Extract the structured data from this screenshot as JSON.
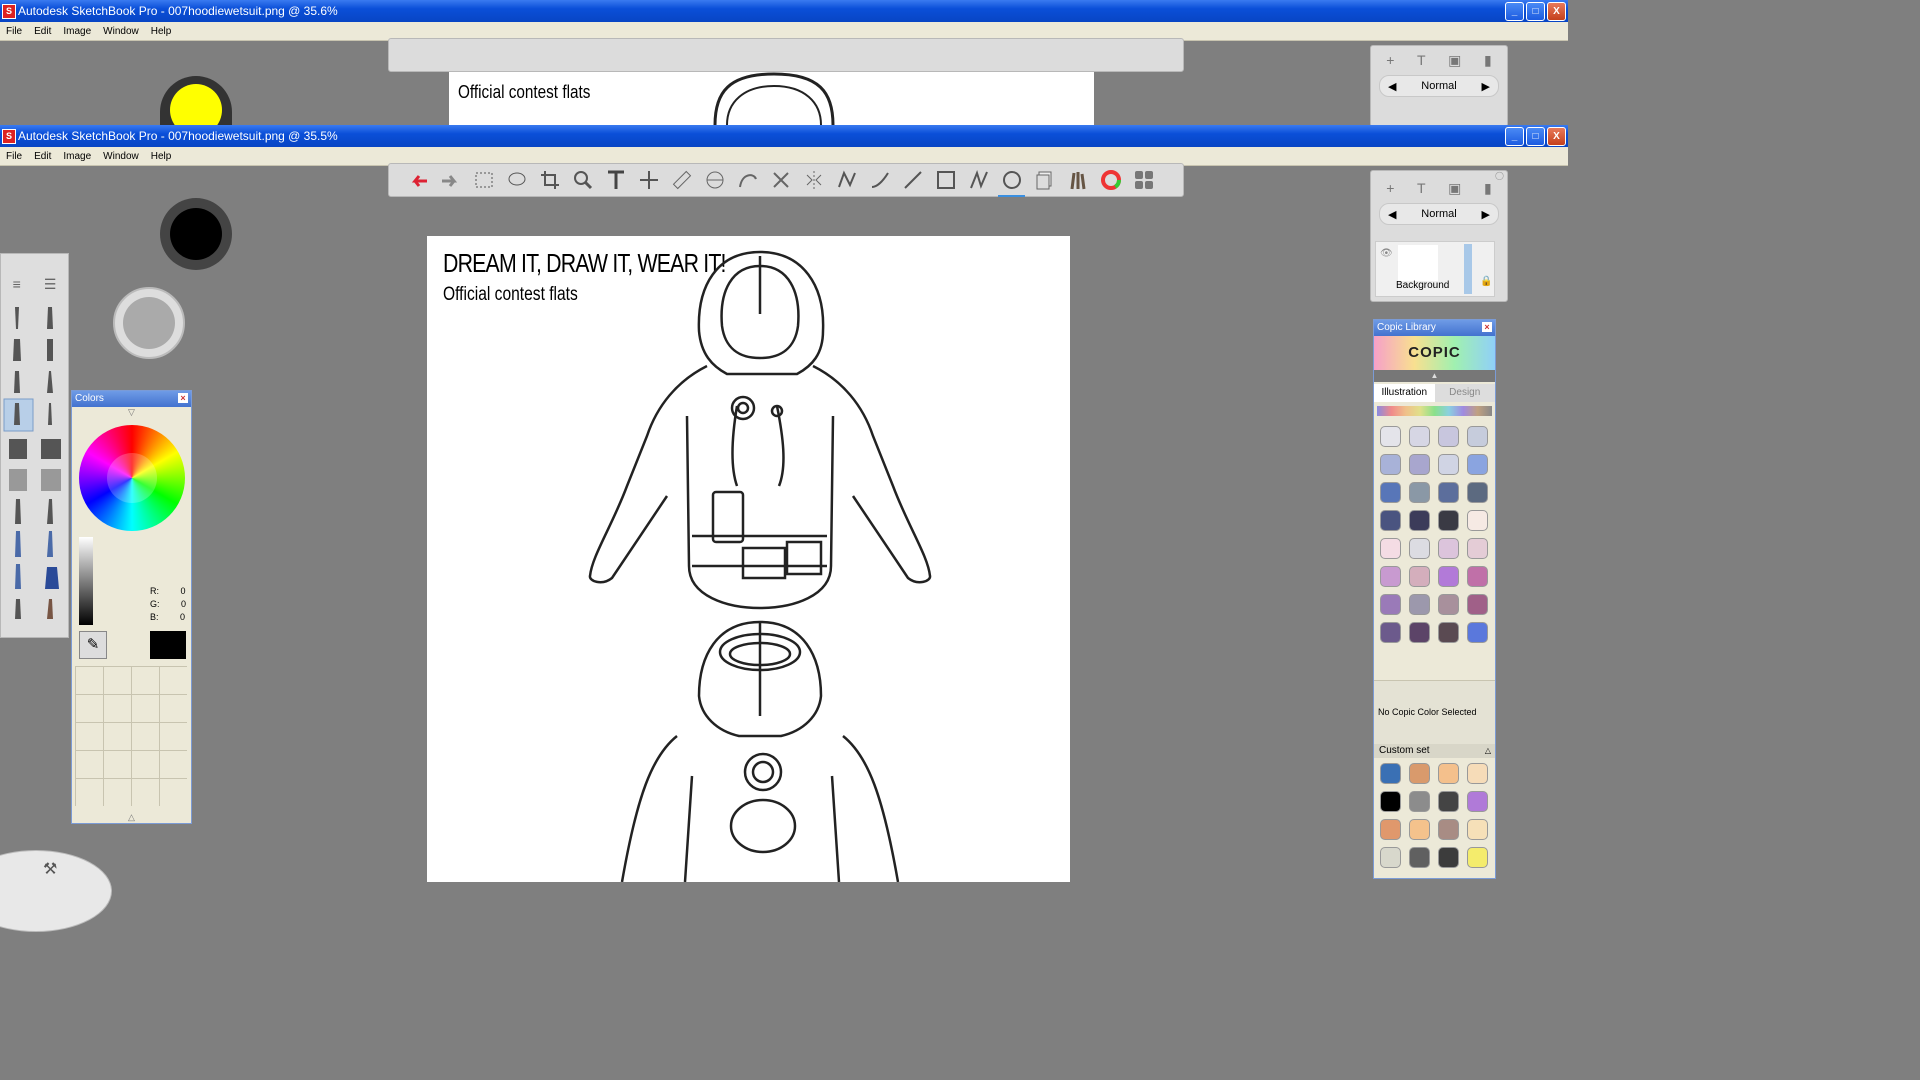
{
  "window_back": {
    "title": "Autodesk SketchBook Pro - 007hoodiewetsuit.png @ 35.6%",
    "canvas_text": "Official contest flats"
  },
  "window_front": {
    "title": "Autodesk SketchBook Pro - 007hoodiewetsuit.png @ 35.5%"
  },
  "menu": [
    "File",
    "Edit",
    "Image",
    "Window",
    "Help"
  ],
  "window_buttons": {
    "minimize": "_",
    "maximize": "□",
    "close": "X"
  },
  "app_icon": "S",
  "toolbar_icons": [
    "undo-icon",
    "redo-icon",
    "rect-select-icon",
    "lasso-icon",
    "crop-icon",
    "zoom-icon",
    "text-icon",
    "move-icon",
    "ruler-icon",
    "ellipse-guide-icon",
    "french-curve-icon",
    "symmetry-x-icon",
    "symmetry-y-icon",
    "pencil-stroke-icon",
    "curve-icon",
    "line-icon",
    "rectangle-icon",
    "polyline-icon",
    "ellipse-icon",
    "layers-icon",
    "brush-palette-icon",
    "color-wheel-icon",
    "copic-icon"
  ],
  "layers": {
    "blend_mode": "Normal",
    "background_label": "Background"
  },
  "canvas": {
    "heading": "DREAM IT, DRAW IT, WEAR IT!",
    "subheading": "Official contest flats"
  },
  "colors_panel": {
    "title": "Colors",
    "r_label": "R:",
    "r_value": "0",
    "g_label": "G:",
    "g_value": "0",
    "b_label": "B:",
    "b_value": "0",
    "current_color": "#000000"
  },
  "copic_panel": {
    "title": "Copic Library",
    "logo": "COPIC",
    "tab_illustration": "Illustration",
    "tab_design": "Design",
    "status": "No Copic Color Selected",
    "custom_set_label": "Custom set",
    "swatches": [
      "#e4e4ea",
      "#d6d6e4",
      "#c8c6de",
      "#c6ccdc",
      "#a8b2d8",
      "#a8a6ce",
      "#d0d4e4",
      "#8aa4e0",
      "#5876b8",
      "#8a98a6",
      "#5c6e9c",
      "#5c6a80",
      "#4a5480",
      "#3c3c5a",
      "#3a3a44",
      "#f6eae4",
      "#f4dce4",
      "#dcdce2",
      "#dcc4dc",
      "#e4ccd6",
      "#c89ad0",
      "#d4aebc",
      "#b27ad8",
      "#c070a8",
      "#9a7ab8",
      "#9c98ac",
      "#a8909c",
      "#a06088",
      "#6c5a8c",
      "#5c4468",
      "#5a4a52",
      "#5a78dc"
    ],
    "custom_swatches": [
      "#3a70b4",
      "#d99a6c",
      "#f4c08c",
      "#f6dcb8",
      "#000000",
      "#8c8c8c",
      "#444444",
      "#b07ad8",
      "#e0986c",
      "#f4c28c",
      "#a88c84",
      "#f6e0b8",
      "#d8d8cc",
      "#606060",
      "#3c3c3c",
      "#f4ec6c"
    ]
  },
  "pucks": {
    "back_color": "#ffff00",
    "front_color": "#000000"
  }
}
